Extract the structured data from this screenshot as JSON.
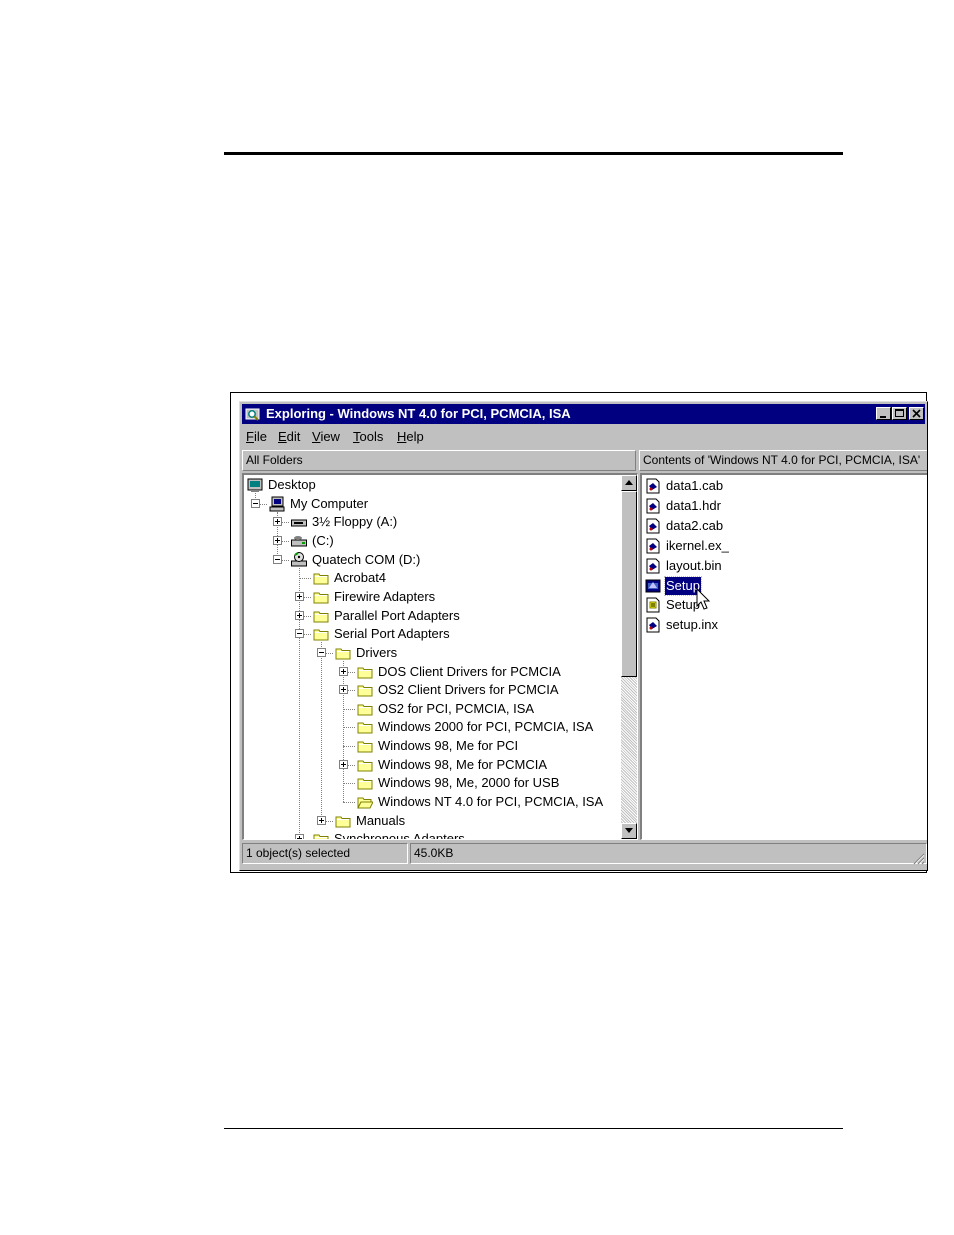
{
  "window": {
    "title": "Exploring - Windows NT 4.0 for PCI, PCMCIA, ISA",
    "controls": [
      "minimize-icon",
      "maximize-icon",
      "close-icon"
    ]
  },
  "menu": [
    {
      "accel": "F",
      "rest": "ile"
    },
    {
      "accel": "E",
      "rest": "dit"
    },
    {
      "accel": "V",
      "rest": "iew"
    },
    {
      "accel": "T",
      "rest": "ools"
    },
    {
      "accel": "H",
      "rest": "elp"
    }
  ],
  "left_pane": {
    "header": "All Folders",
    "tree": [
      {
        "label": "Desktop",
        "icon": "desktop-icon"
      },
      {
        "label": "My Computer",
        "icon": "computer-icon",
        "expander": "minus"
      },
      {
        "label": "3½ Floppy (A:)",
        "icon": "floppy-drive-icon",
        "expander": "plus"
      },
      {
        "label": "(C:)",
        "icon": "hard-drive-icon",
        "expander": "plus"
      },
      {
        "label": "Quatech COM (D:)",
        "icon": "cd-drive-icon",
        "expander": "minus"
      },
      {
        "label": "Acrobat4",
        "icon": "folder-icon"
      },
      {
        "label": "Firewire Adapters",
        "icon": "folder-icon",
        "expander": "plus"
      },
      {
        "label": "Parallel Port Adapters",
        "icon": "folder-icon",
        "expander": "plus"
      },
      {
        "label": "Serial Port Adapters",
        "icon": "folder-icon",
        "expander": "minus"
      },
      {
        "label": "Drivers",
        "icon": "folder-icon",
        "expander": "minus"
      },
      {
        "label": "DOS Client Drivers for PCMCIA",
        "icon": "folder-icon",
        "expander": "plus"
      },
      {
        "label": "OS2 Client Drivers for PCMCIA",
        "icon": "folder-icon",
        "expander": "plus"
      },
      {
        "label": "OS2 for PCI, PCMCIA, ISA",
        "icon": "folder-icon"
      },
      {
        "label": "Windows 2000 for PCI, PCMCIA, ISA",
        "icon": "folder-icon"
      },
      {
        "label": "Windows 98, Me for PCI",
        "icon": "folder-icon"
      },
      {
        "label": "Windows 98, Me for PCMCIA",
        "icon": "folder-icon",
        "expander": "plus"
      },
      {
        "label": "Windows 98, Me, 2000 for USB",
        "icon": "folder-icon"
      },
      {
        "label": "Windows NT 4.0 for PCI, PCMCIA, ISA",
        "icon": "open-folder-icon"
      },
      {
        "label": "Manuals",
        "icon": "folder-icon",
        "expander": "plus"
      },
      {
        "label": "Synchronous Adapters",
        "icon": "folder-icon",
        "expander": "plus"
      }
    ]
  },
  "right_pane": {
    "header": "Contents of 'Windows NT 4.0 for PCI, PCMCIA, ISA'",
    "files": [
      {
        "name": "data1.cab",
        "icon": "file-icon"
      },
      {
        "name": "data1.hdr",
        "icon": "file-icon"
      },
      {
        "name": "data2.cab",
        "icon": "file-icon"
      },
      {
        "name": "ikernel.ex_",
        "icon": "file-icon"
      },
      {
        "name": "layout.bin",
        "icon": "file-icon"
      },
      {
        "name": "Setup",
        "icon": "setup-exe-icon",
        "selected": true
      },
      {
        "name": "Setup",
        "icon": "settings-file-icon"
      },
      {
        "name": "setup.inx",
        "icon": "file-icon"
      }
    ]
  },
  "status": {
    "selection": "1 object(s) selected",
    "size": "45.0KB"
  }
}
